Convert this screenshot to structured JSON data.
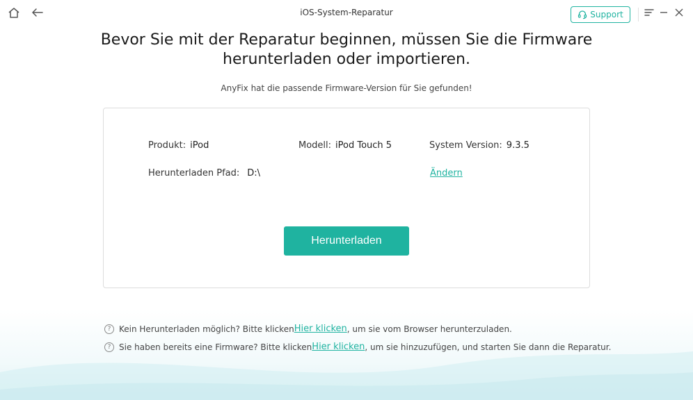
{
  "window": {
    "title": "iOS-System-Reparatur",
    "support_label": "Support"
  },
  "headline": "Bevor Sie mit der Reparatur beginnen, müssen Sie die Firmware herunterladen oder importieren.",
  "subline": "AnyFix hat die passende Firmware-Version für Sie gefunden!",
  "device": {
    "product_label": "Produkt:",
    "product_value": "iPod",
    "model_label": "Modell:",
    "model_value": "iPod Touch 5",
    "version_label": "System Version:",
    "version_value": "9.3.5",
    "path_label": "Herunterladen Pfad:",
    "path_value": "D:\\",
    "change_label": "Ändern"
  },
  "download_label": "Herunterladen",
  "help": [
    {
      "prefix": "Kein Herunterladen möglich? Bitte klicken ",
      "link": "Hier klicken",
      "suffix": ", um sie vom Browser herunterzuladen."
    },
    {
      "prefix": "Sie haben bereits eine Firmware? Bitte klicken ",
      "link": "Hier klicken",
      "suffix": ", um sie hinzuzufügen, und starten Sie dann die Reparatur."
    }
  ],
  "help_icon_glyph": "?",
  "icons": [
    "home-icon",
    "back-icon",
    "headset-icon",
    "menu-icon",
    "minimize-icon",
    "close-icon",
    "help-icon"
  ],
  "colors": {
    "accent": "#1fb3a0"
  }
}
